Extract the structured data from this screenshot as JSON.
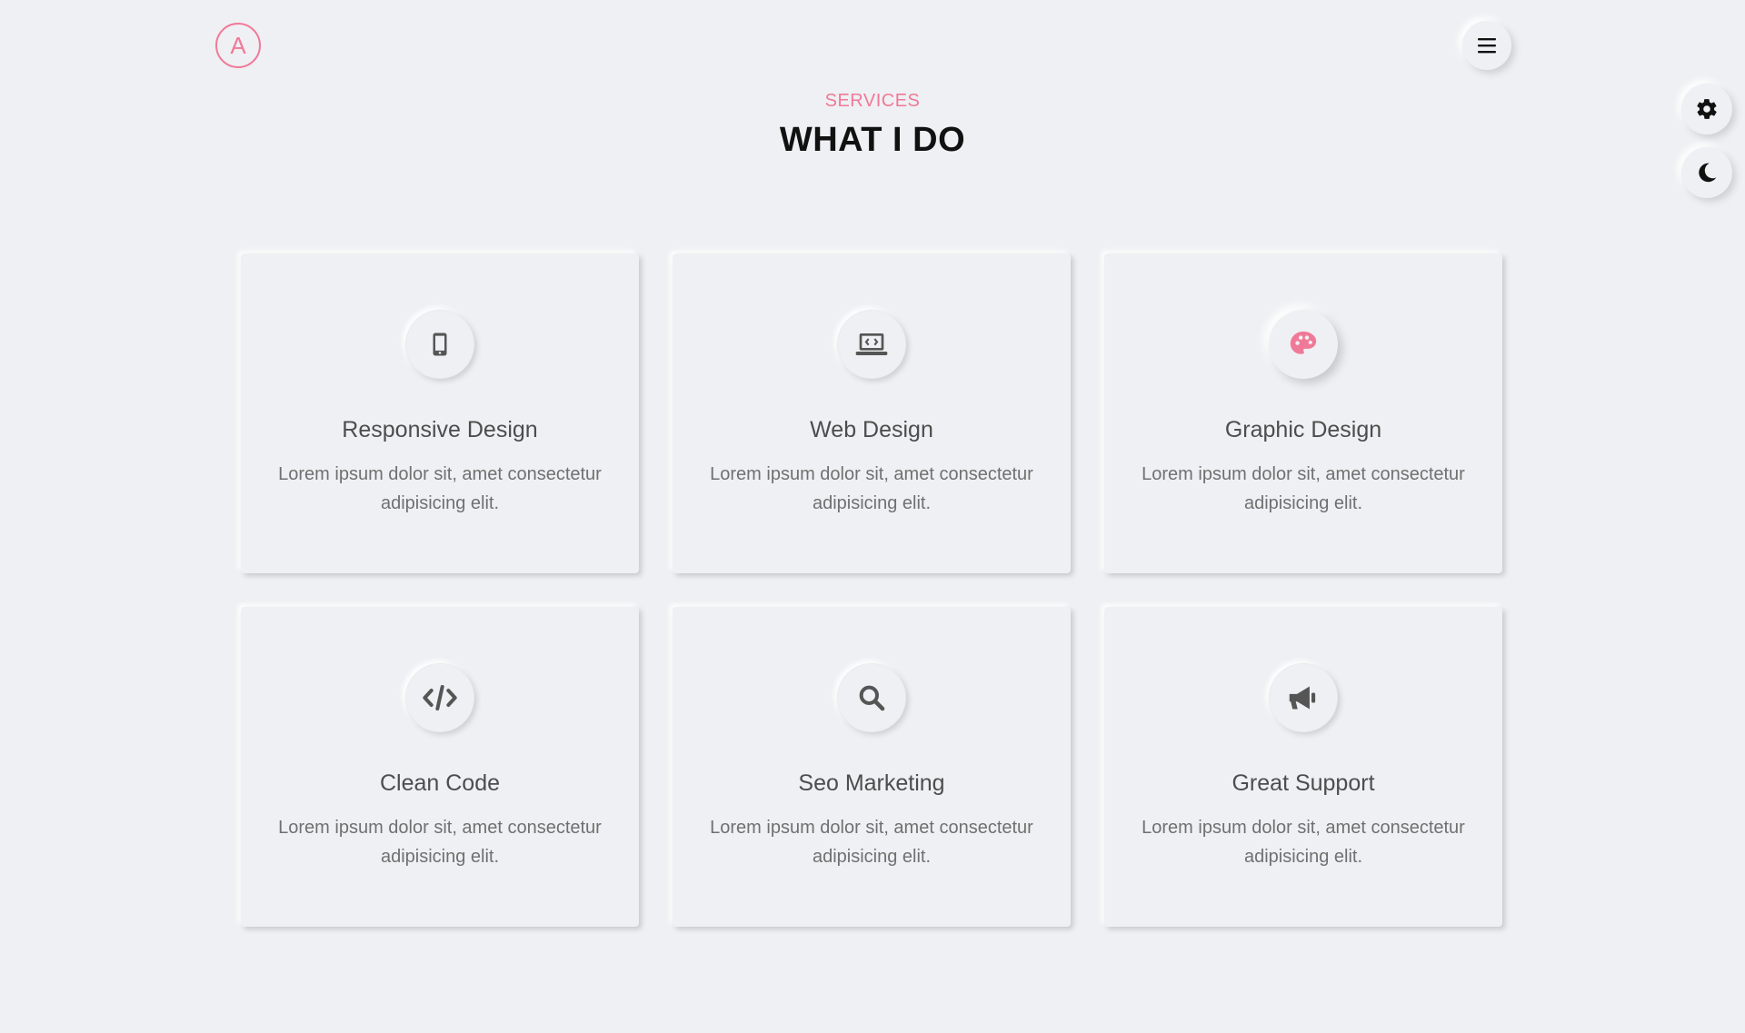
{
  "header": {
    "logo_letter": "A",
    "menu_icon": "hamburger-menu-icon"
  },
  "side_controls": {
    "settings_icon": "gear-icon",
    "theme_icon": "moon-icon"
  },
  "section": {
    "subtitle": "SERVICES",
    "title": "WHAT I DO"
  },
  "colors": {
    "accent": "#f17998",
    "background": "#eff0f3",
    "icon": "#555555"
  },
  "services": [
    {
      "title": "Responsive Design",
      "text": "Lorem ipsum dolor sit, amet consectetur adipisicing elit.",
      "icon": "mobile-phone-icon"
    },
    {
      "title": "Web Design",
      "text": "Lorem ipsum dolor sit, amet consectetur adipisicing elit.",
      "icon": "laptop-code-icon"
    },
    {
      "title": "Graphic Design",
      "text": "Lorem ipsum dolor sit, amet consectetur adipisicing elit.",
      "icon": "palette-icon"
    },
    {
      "title": "Clean Code",
      "text": "Lorem ipsum dolor sit, amet consectetur adipisicing elit.",
      "icon": "code-icon"
    },
    {
      "title": "Seo Marketing",
      "text": "Lorem ipsum dolor sit, amet consectetur adipisicing elit.",
      "icon": "search-icon"
    },
    {
      "title": "Great Support",
      "text": "Lorem ipsum dolor sit, amet consectetur adipisicing elit.",
      "icon": "megaphone-icon"
    }
  ]
}
